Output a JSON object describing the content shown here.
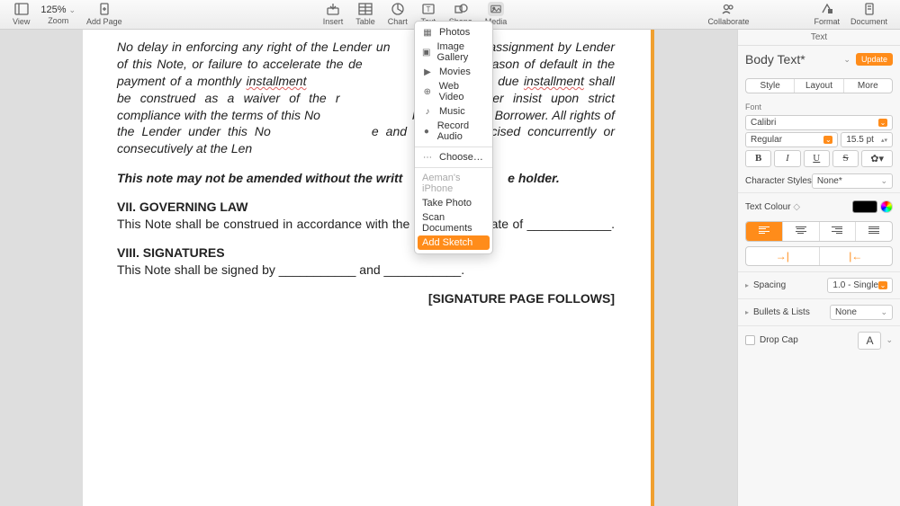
{
  "toolbar": {
    "view": "View",
    "zoom_label": "Zoom",
    "zoom_value": "125%",
    "add_page": "Add Page",
    "insert": "Insert",
    "table": "Table",
    "chart": "Chart",
    "text": "Text",
    "shape": "Shape",
    "media": "Media",
    "collaborate": "Collaborate",
    "format": "Format",
    "document": "Document"
  },
  "dropdown": {
    "photos": "Photos",
    "image_gallery": "Image Gallery",
    "movies": "Movies",
    "web_video": "Web Video",
    "music": "Music",
    "record_audio": "Record Audio",
    "choose": "Choose…",
    "iphone": "Aeman's iPhone",
    "take_photo": "Take Photo",
    "scan_documents": "Scan Documents",
    "add_sketch": "Add Sketch"
  },
  "document": {
    "p1a": "No delay in enforcing any right of the Lender un",
    "p1b": " assignment by Lender of this Note, or failure to accelerate the de",
    "p1c": "by by reason  of default in the payment of a monthly ",
    "p1d": "installment",
    "p1e": "e of a past- due ",
    "p1f": "installment",
    "p1g": " shall be construed as a waiver of the r",
    "p1h": " thereafter insist upon strict compliance with the terms of this No",
    "p1i": " being  given to Borrower. All rights of the Lender under this No",
    "p1j": "e and  may be exercised concurrently or consecutively at the Len",
    "p2a": "This note may not be amended without the writt",
    "p2b": "e holder.",
    "h1": "VII. GOVERNING LAW",
    "p3": "This Note shall be construed in accordance with the laws of the State of ____________.",
    "h2": "VIII. SIGNATURES",
    "p4": "This Note shall be signed by ___________ and ___________.",
    "sig": "[SIGNATURE PAGE FOLLOWS]"
  },
  "inspector": {
    "tab": "Text",
    "style_name": "Body Text*",
    "update": "Update",
    "seg_style": "Style",
    "seg_layout": "Layout",
    "seg_more": "More",
    "font_label": "Font",
    "font_family": "Calibri",
    "font_weight": "Regular",
    "font_size": "15.5 pt",
    "char_styles_label": "Character Styles",
    "char_styles_value": "None*",
    "text_colour_label": "Text Colour",
    "spacing_label": "Spacing",
    "spacing_value": "1.0 - Single",
    "bullets_label": "Bullets & Lists",
    "bullets_value": "None",
    "dropcap_label": "Drop Cap",
    "dropcap_value": "A"
  }
}
